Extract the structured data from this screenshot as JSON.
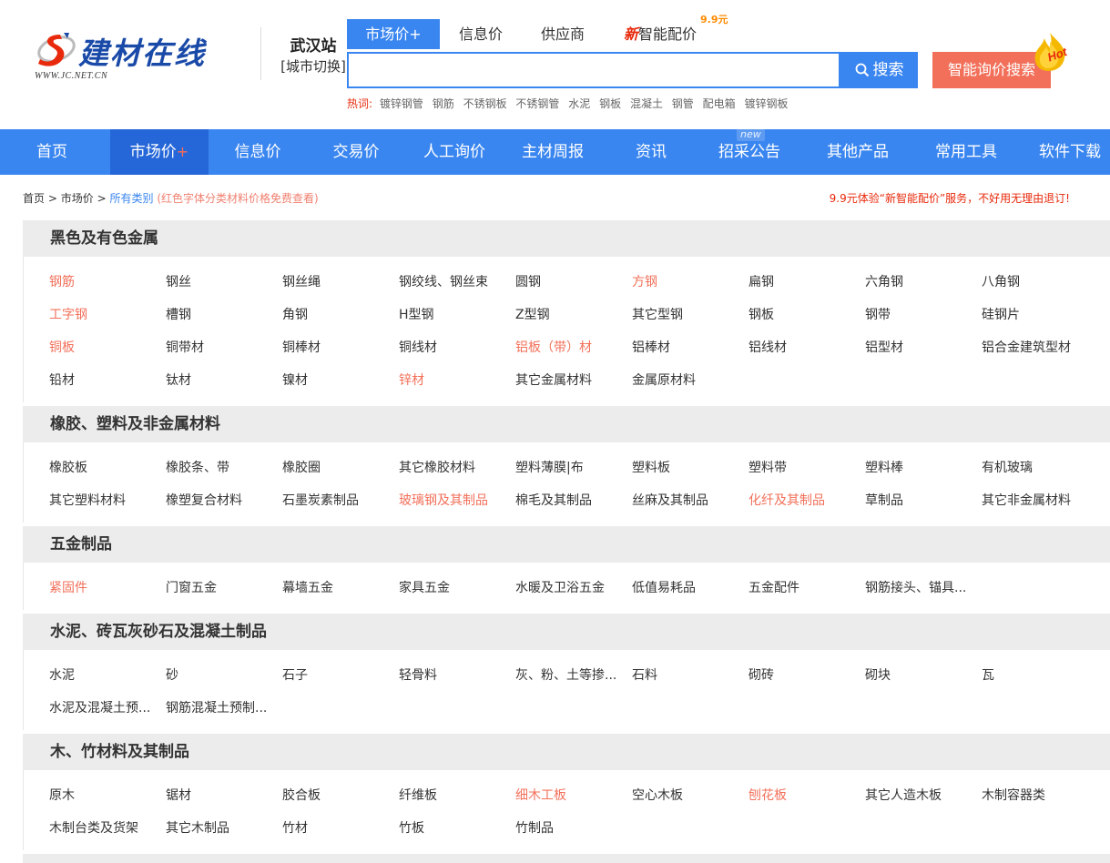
{
  "header": {
    "logo_text": "建材在线",
    "logo_url": "WWW.JC.NET.CN",
    "city_name": "武汉站",
    "city_switch": "[城市切换]",
    "search_tabs": [
      {
        "label": "市场价",
        "plus": "+",
        "active": true
      },
      {
        "label": "信息价"
      },
      {
        "label": "供应商"
      },
      {
        "new": "新",
        "label": "智能配价",
        "price": "9.9元"
      }
    ],
    "search_placeholder": "",
    "search_button": "搜索",
    "smart_button": "智能询价搜索",
    "hot_badge": "Hot",
    "hot_label": "热词:",
    "hot_words": [
      "镀锌钢管",
      "钢筋",
      "不锈钢板",
      "不锈钢管",
      "水泥",
      "钢板",
      "混凝土",
      "钢管",
      "配电箱",
      "镀锌钢板"
    ]
  },
  "nav": {
    "items": [
      {
        "label": "首页"
      },
      {
        "label": "市场价",
        "plus": "+",
        "active": true
      },
      {
        "label": "信息价"
      },
      {
        "label": "交易价"
      },
      {
        "label": "人工询价"
      },
      {
        "label": "主材周报"
      },
      {
        "label": "资讯"
      },
      {
        "label": "招采公告",
        "tag": "new"
      },
      {
        "label": "其他产品"
      },
      {
        "label": "常用工具"
      },
      {
        "label": "软件下载"
      }
    ]
  },
  "breadcrumb": {
    "home": "首页",
    "sep": ">",
    "market": "市场价",
    "current": "所有类别",
    "note": "(红色字体分类材料价格免费查看)"
  },
  "promo": "9.9元体验“新智能配价”服务，不好用无理由退订!",
  "sections": [
    {
      "title": "黑色及有色金属",
      "rows": [
        [
          {
            "t": "钢筋",
            "red": true
          },
          {
            "t": "钢丝"
          },
          {
            "t": "钢丝绳"
          },
          {
            "t": "钢绞线、钢丝束"
          },
          {
            "t": "圆钢"
          },
          {
            "t": "方钢",
            "red": true
          },
          {
            "t": "扁钢"
          },
          {
            "t": "六角钢"
          },
          {
            "t": "八角钢"
          }
        ],
        [
          {
            "t": "工字钢",
            "red": true
          },
          {
            "t": "槽钢"
          },
          {
            "t": "角钢"
          },
          {
            "t": "H型钢"
          },
          {
            "t": "Z型钢"
          },
          {
            "t": "其它型钢"
          },
          {
            "t": "钢板"
          },
          {
            "t": "钢带"
          },
          {
            "t": "硅钢片"
          }
        ],
        [
          {
            "t": "铜板",
            "red": true
          },
          {
            "t": "铜带材"
          },
          {
            "t": "铜棒材"
          },
          {
            "t": "铜线材"
          },
          {
            "t": "铝板（带）材",
            "red": true
          },
          {
            "t": "铝棒材"
          },
          {
            "t": "铝线材"
          },
          {
            "t": "铝型材"
          },
          {
            "t": "铝合金建筑型材"
          }
        ],
        [
          {
            "t": "铅材"
          },
          {
            "t": "钛材"
          },
          {
            "t": "镍材"
          },
          {
            "t": "锌材",
            "red": true
          },
          {
            "t": "其它金属材料"
          },
          {
            "t": "金属原材料"
          }
        ]
      ]
    },
    {
      "title": "橡胶、塑料及非金属材料",
      "rows": [
        [
          {
            "t": "橡胶板"
          },
          {
            "t": "橡胶条、带"
          },
          {
            "t": "橡胶圈"
          },
          {
            "t": "其它橡胶材料"
          },
          {
            "t": "塑料薄膜|布"
          },
          {
            "t": "塑料板"
          },
          {
            "t": "塑料带"
          },
          {
            "t": "塑料棒"
          },
          {
            "t": "有机玻璃"
          }
        ],
        [
          {
            "t": "其它塑料材料"
          },
          {
            "t": "橡塑复合材料"
          },
          {
            "t": "石墨炭素制品"
          },
          {
            "t": "玻璃钢及其制品",
            "red": true
          },
          {
            "t": "棉毛及其制品"
          },
          {
            "t": "丝麻及其制品"
          },
          {
            "t": "化纤及其制品",
            "red": true
          },
          {
            "t": "草制品"
          },
          {
            "t": "其它非金属材料"
          }
        ]
      ]
    },
    {
      "title": "五金制品",
      "rows": [
        [
          {
            "t": "紧固件",
            "red": true
          },
          {
            "t": "门窗五金"
          },
          {
            "t": "幕墙五金"
          },
          {
            "t": "家具五金"
          },
          {
            "t": "水暖及卫浴五金"
          },
          {
            "t": "低值易耗品"
          },
          {
            "t": "五金配件"
          },
          {
            "t": "钢筋接头、锚具..."
          }
        ]
      ]
    },
    {
      "title": "水泥、砖瓦灰砂石及混凝土制品",
      "rows": [
        [
          {
            "t": "水泥"
          },
          {
            "t": "砂"
          },
          {
            "t": "石子"
          },
          {
            "t": "轻骨料"
          },
          {
            "t": "灰、粉、土等掺..."
          },
          {
            "t": "石料"
          },
          {
            "t": "砌砖"
          },
          {
            "t": "砌块"
          },
          {
            "t": "瓦"
          }
        ],
        [
          {
            "t": "水泥及混凝土预..."
          },
          {
            "t": "钢筋混凝土预制..."
          }
        ]
      ]
    },
    {
      "title": "木、竹材料及其制品",
      "rows": [
        [
          {
            "t": "原木"
          },
          {
            "t": "锯材"
          },
          {
            "t": "胶合板"
          },
          {
            "t": "纤维板"
          },
          {
            "t": "细木工板",
            "red": true
          },
          {
            "t": "空心木板"
          },
          {
            "t": "刨花板",
            "red": true
          },
          {
            "t": "其它人造木板"
          },
          {
            "t": "木制容器类"
          }
        ],
        [
          {
            "t": "木制台类及货架"
          },
          {
            "t": "其它木制品"
          },
          {
            "t": "竹材"
          },
          {
            "t": "竹板"
          },
          {
            "t": "竹制品"
          }
        ]
      ]
    }
  ],
  "colors": {
    "brand_blue": "#3a86f0",
    "nav_active": "#2567d8",
    "accent_red": "#f2705a",
    "promo_red": "#e8290b",
    "section_bg": "#ececec"
  }
}
